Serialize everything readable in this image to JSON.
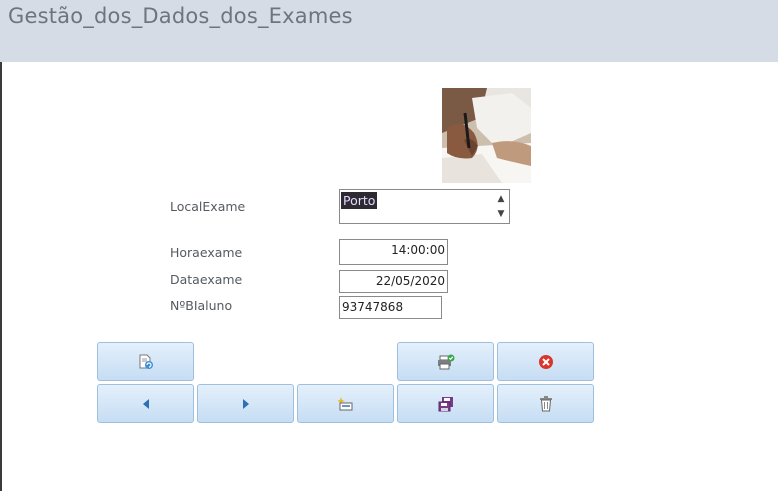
{
  "header": {
    "title": "Gestão_dos_Dados_dos_Exames"
  },
  "form": {
    "local_exame": {
      "label": "LocalExame",
      "value": "Porto"
    },
    "hora_exame": {
      "label": "Horaexame",
      "value": "14:00:00"
    },
    "data_exame": {
      "label": "Dataexame",
      "value": "22/05/2020"
    },
    "nbi_aluno": {
      "label": "NºBIaluno",
      "value": "93747868"
    }
  },
  "buttons": {
    "refresh": {
      "icon": "refresh-form-icon"
    },
    "save_record": {
      "icon": "save-check-icon"
    },
    "close": {
      "icon": "close-icon",
      "color": "#d9352b"
    },
    "previous": {
      "icon": "triangle-left-icon",
      "color": "#2e6fb7"
    },
    "next": {
      "icon": "triangle-right-icon",
      "color": "#2e6fb7"
    },
    "new_record": {
      "icon": "new-record-icon"
    },
    "save": {
      "icon": "floppy-disk-icon",
      "color": "#7a3a8c"
    },
    "delete": {
      "icon": "trash-icon"
    }
  },
  "colors": {
    "header_bg": "#d6dce6",
    "button_border": "#9fbfdf",
    "selection_bg": "#2d2a32"
  }
}
